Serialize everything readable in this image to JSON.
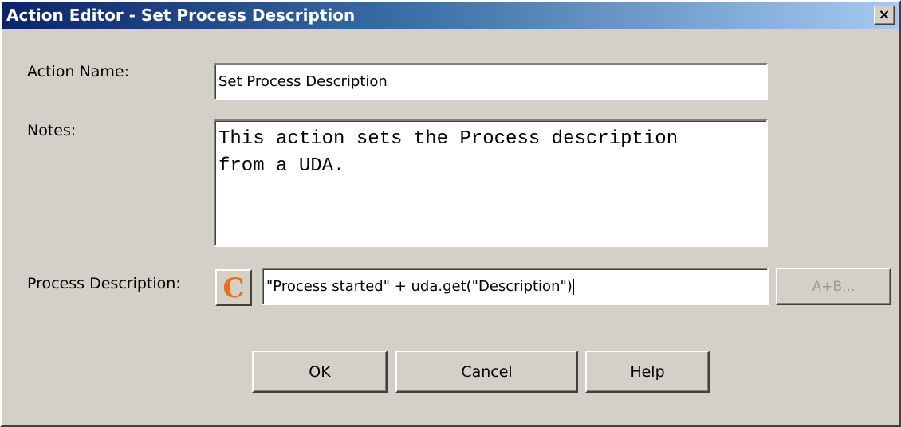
{
  "window": {
    "title": "Action Editor - Set Process Description",
    "close_label": "×"
  },
  "form": {
    "action_name_label": "Action Name:",
    "action_name_value": "Set Process Description",
    "notes_label": "Notes:",
    "notes_value": "This action sets the Process description\nfrom a UDA.",
    "process_description_label": "Process Description:",
    "process_description_value": "\"Process started\" + uda.get(\"Description\")",
    "calc_button_label": "C",
    "expression_button_label": "A+B..."
  },
  "buttons": {
    "ok": "OK",
    "cancel": "Cancel",
    "help": "Help"
  },
  "icons": {
    "calc": "c-icon",
    "close": "close-icon"
  },
  "colors": {
    "title_gradient_start": "#0a246a",
    "title_gradient_end": "#a6caf0",
    "dialog_bg": "#d4d0c8",
    "c_icon": "#e8701a"
  }
}
